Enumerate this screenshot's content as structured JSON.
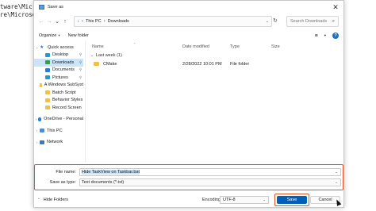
{
  "console": {
    "line1": "tware\\Micros",
    "line2": "re\\Microsoft"
  },
  "dialog": {
    "title": "Save as",
    "close_glyph": "✕"
  },
  "address_bar": {
    "back_glyph": "←",
    "forward_glyph": "→",
    "down_glyph": "⌄",
    "up_glyph": "↑",
    "down_arrow_glyph": "↓",
    "crumbs": [
      "This PC",
      "Downloads"
    ],
    "sep_glyph": "›",
    "dropdown_glyph": "⌄",
    "refresh_glyph": "↻"
  },
  "search": {
    "placeholder": "Search Downloads",
    "icon_glyph": "⌕"
  },
  "toolbar": {
    "organize_label": "Organize",
    "new_folder_label": "New folder",
    "caret": "▾",
    "view_glyph": "≡",
    "help_glyph": "?"
  },
  "nav": {
    "items": [
      {
        "label": "Quick access",
        "icon": "star-icon",
        "expanded": true,
        "pinned": false
      },
      {
        "label": "Desktop",
        "icon": "desktop-icon",
        "pinned": true
      },
      {
        "label": "Downloads",
        "icon": "downloads-icon",
        "pinned": true,
        "selected": true
      },
      {
        "label": "Documents",
        "icon": "documents-icon",
        "pinned": true
      },
      {
        "label": "Pictures",
        "icon": "pictures-icon",
        "pinned": true
      },
      {
        "label": "A Windows SubSyst",
        "icon": "folder-icon"
      },
      {
        "label": "Batch Script",
        "icon": "folder-icon"
      },
      {
        "label": "Behavior Styles",
        "icon": "folder-icon"
      },
      {
        "label": "Record Screen",
        "icon": "folder-icon"
      },
      {
        "label": "OneDrive - Personal",
        "icon": "onedrive-icon"
      },
      {
        "label": "This PC",
        "icon": "this-pc-icon"
      },
      {
        "label": "Network",
        "icon": "network-icon"
      }
    ],
    "chevron_down": "⌄",
    "chevron_right": "›",
    "pin_glyph": "⚲"
  },
  "file_list": {
    "columns": [
      "Name",
      "Date modified",
      "Type",
      "Size"
    ],
    "sort_caret": "⌃",
    "group_label": "Last week (1)",
    "group_caret": "⌄",
    "rows": [
      {
        "name": "CMake",
        "date": "2/28/2022 10:01 PM",
        "type": "File folder",
        "size": ""
      }
    ]
  },
  "fields": {
    "file_name_label": "File name:",
    "file_name_value": "Hide TaskView on Taskbar.bat",
    "save_type_label": "Save as type:",
    "save_type_value": "Text documents (*.txt)",
    "caret": "⌄"
  },
  "footer": {
    "hide_folders_label": "Hide Folders",
    "hide_caret": "⌃",
    "encoding_label": "Encoding:",
    "encoding_value": "UTF-8",
    "encoding_caret": "⌄",
    "save_label": "Save",
    "cancel_label": "Cancel",
    "grip_glyph": "⋰"
  },
  "colors": {
    "accent": "#005fb8",
    "highlight_border": "#d9562c",
    "selection": "#cce4f7",
    "folder": "#f2c04a"
  }
}
